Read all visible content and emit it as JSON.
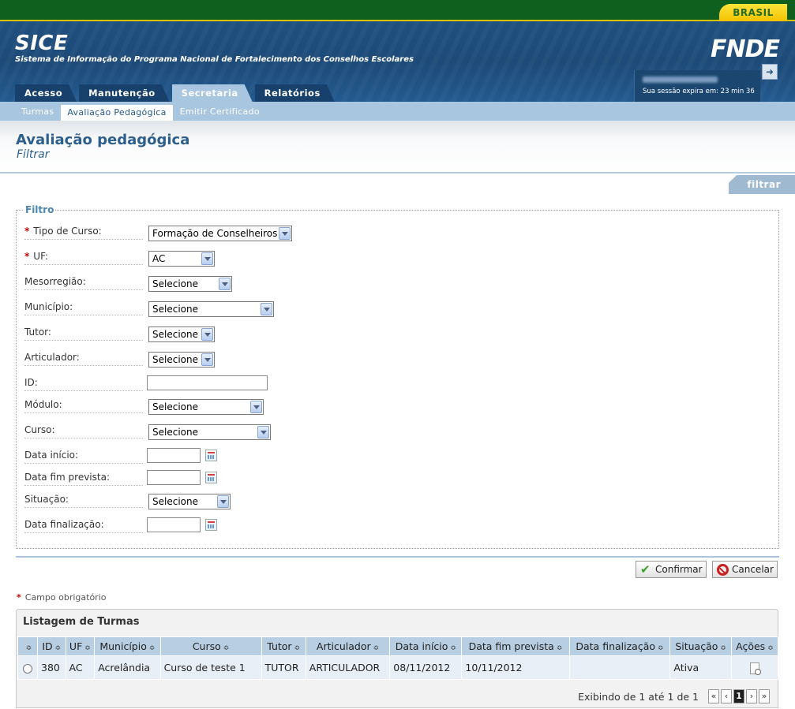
{
  "gov_bar": {
    "brand": "BRASIL"
  },
  "header": {
    "title": "SICE",
    "subtitle": "Sistema de Informação do Programa Nacional de Fortalecimento dos Conselhos Escolares",
    "logo": "FNDE",
    "session_text": "Sua sessão expira em: 23 min 36",
    "logout_icon": "logout-icon"
  },
  "menu": {
    "items": [
      {
        "label": "Acesso"
      },
      {
        "label": "Manutenção"
      },
      {
        "label": "Secretaria"
      },
      {
        "label": "Relatórios"
      }
    ],
    "active": "Secretaria"
  },
  "submenu": {
    "items": [
      {
        "label": "Turmas"
      },
      {
        "label": "Avaliação Pedagógica"
      },
      {
        "label": "Emitir Certificado"
      }
    ],
    "active": "Avaliação Pedagógica"
  },
  "page": {
    "title": "Avaliação pedagógica",
    "subtitle": "Filtrar",
    "tab": "filtrar"
  },
  "filter": {
    "legend": "Filtro",
    "required_mark": "*",
    "fields": {
      "tipo_curso": {
        "label": "Tipo de Curso:",
        "value": "Formação de Conselheiros"
      },
      "uf": {
        "label": "UF:",
        "value": "AC"
      },
      "mesorregiao": {
        "label": "Mesorregião:",
        "value": "Selecione"
      },
      "municipio": {
        "label": "Município:",
        "value": "Selecione"
      },
      "tutor": {
        "label": "Tutor:",
        "value": "Selecione"
      },
      "articulador": {
        "label": "Articulador:",
        "value": "Selecione"
      },
      "id": {
        "label": "ID:",
        "value": ""
      },
      "modulo": {
        "label": "Módulo:",
        "value": "Selecione"
      },
      "curso": {
        "label": "Curso:",
        "value": "Selecione"
      },
      "data_inicio": {
        "label": "Data início:",
        "value": ""
      },
      "data_fim_prevista": {
        "label": "Data fim prevista:",
        "value": ""
      },
      "situacao": {
        "label": "Situação:",
        "value": "Selecione"
      },
      "data_finalizacao": {
        "label": "Data finalização:",
        "value": ""
      }
    }
  },
  "actions": {
    "confirm": "Confirmar",
    "cancel": "Cancelar"
  },
  "required_note": "Campo obrigatório",
  "listing": {
    "title": "Listagem de Turmas",
    "sort_glyph": "≎",
    "columns": [
      "ID",
      "UF",
      "Município",
      "Curso",
      "Tutor",
      "Articulador",
      "Data início",
      "Data fim prevista",
      "Data finalização",
      "Situação",
      "Ações"
    ],
    "rows": [
      {
        "id": "380",
        "uf": "AC",
        "municipio": "Acrelândia",
        "curso": "Curso de teste 1",
        "tutor": "TUTOR",
        "articulador": "ARTICULADOR",
        "data_inicio": "08/11/2012",
        "data_fim_prevista": "10/11/2012",
        "data_finalizacao": "",
        "situacao": "Ativa"
      }
    ],
    "pager": {
      "text": "Exibindo de 1 até 1 de 1",
      "first": "«",
      "prev": "‹",
      "current": "1",
      "next": "›",
      "last": "»"
    }
  }
}
